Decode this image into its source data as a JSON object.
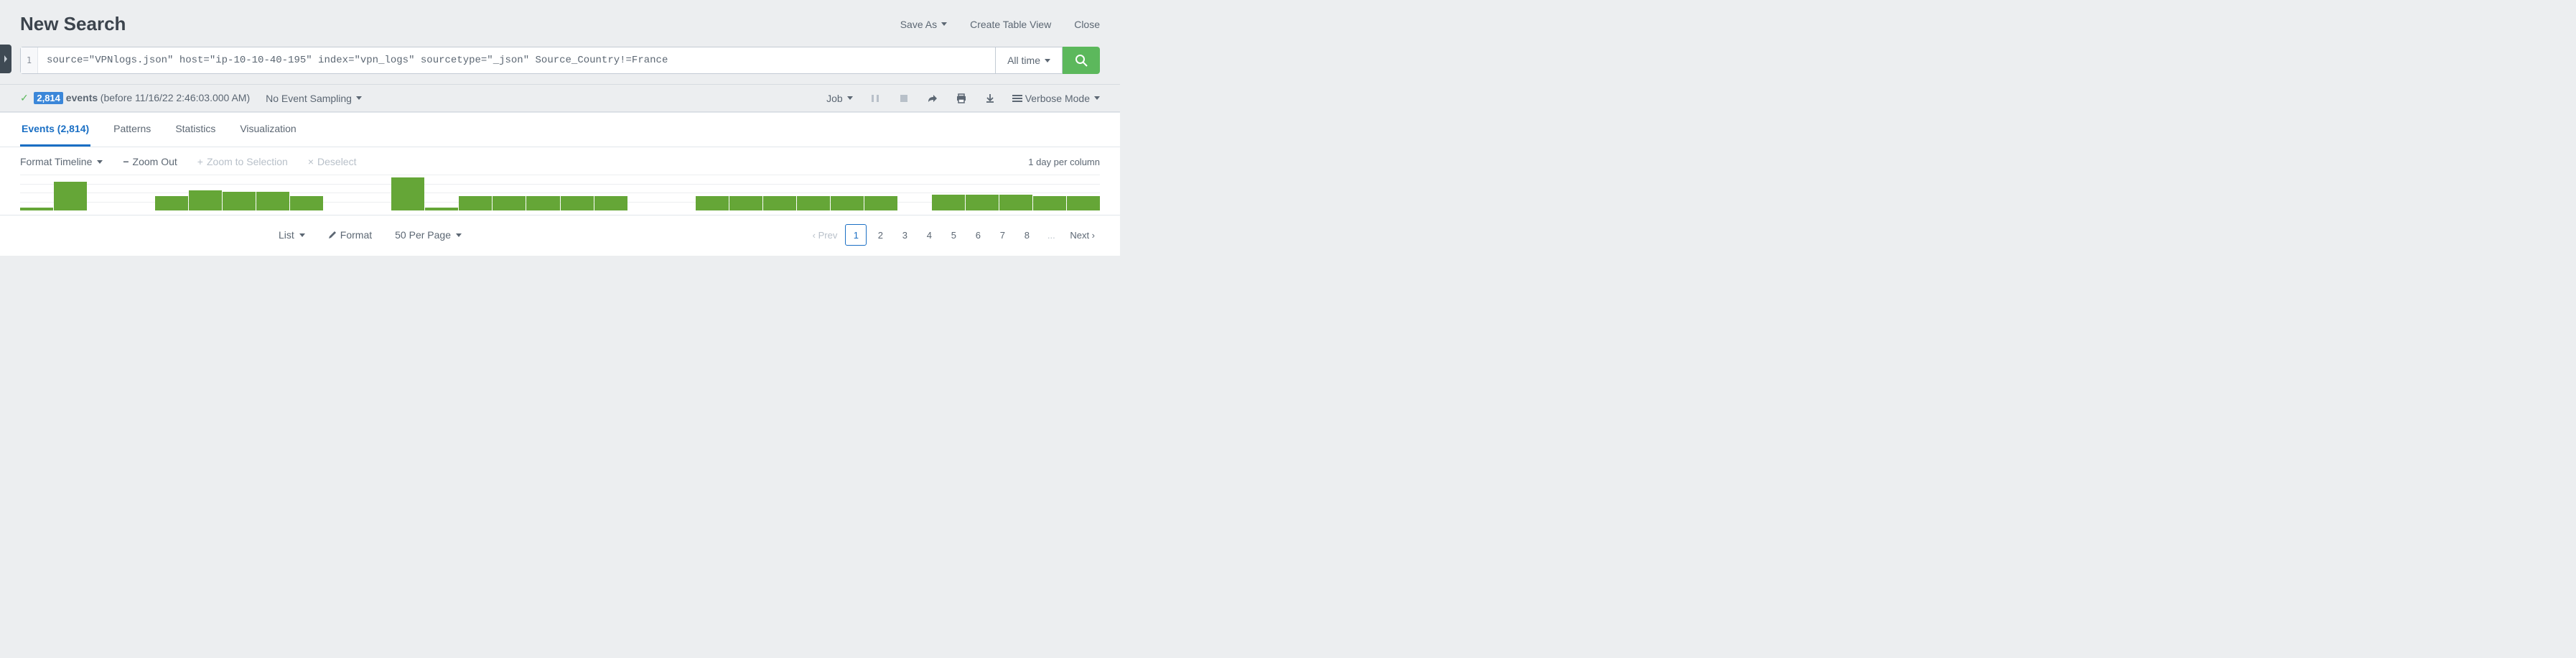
{
  "page_title": "New Search",
  "header_actions": {
    "save_as": "Save As",
    "create_table_view": "Create Table View",
    "close": "Close"
  },
  "search": {
    "line_number": "1",
    "query": "source=\"VPNlogs.json\" host=\"ip-10-10-40-195\" index=\"vpn_logs\" sourcetype=\"_json\" Source_Country!=France",
    "time_range": "All time"
  },
  "status": {
    "count_highlight": "2,814",
    "count_label": " events",
    "time_note": "(before 11/16/22 2:46:03.000 AM)",
    "no_event_sampling": "No Event Sampling",
    "job_label": "Job",
    "mode_label": "Verbose Mode"
  },
  "tabs": [
    {
      "label": "Events (2,814)",
      "active": true
    },
    {
      "label": "Patterns",
      "active": false
    },
    {
      "label": "Statistics",
      "active": false
    },
    {
      "label": "Visualization",
      "active": false
    }
  ],
  "timeline": {
    "format_label": "Format Timeline",
    "zoom_out": "Zoom Out",
    "zoom_to_selection": "Zoom to Selection",
    "deselect": "Deselect",
    "per_column": "1 day per column"
  },
  "chart_data": {
    "type": "bar",
    "title": "Event timeline",
    "xlabel": "",
    "ylabel": "",
    "ylim": [
      0,
      50
    ],
    "granularity": "1 day per column",
    "values": [
      4,
      40,
      0,
      0,
      20,
      28,
      26,
      26,
      20,
      0,
      0,
      46,
      4,
      20,
      20,
      20,
      20,
      20,
      0,
      0,
      20,
      20,
      20,
      20,
      20,
      20,
      0,
      22,
      22,
      22,
      20,
      20
    ]
  },
  "footer": {
    "list_label": "List",
    "format_label": "Format",
    "per_page_label": "50 Per Page",
    "prev_label": "Prev",
    "next_label": "Next",
    "pages": [
      "1",
      "2",
      "3",
      "4",
      "5",
      "6",
      "7",
      "8"
    ],
    "ellipsis": "...",
    "active_page": 1
  }
}
